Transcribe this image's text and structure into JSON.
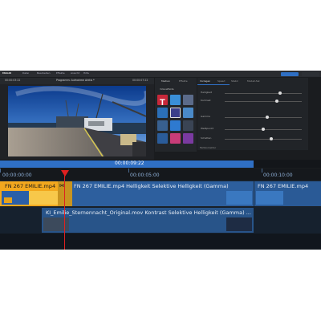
{
  "menu": {
    "logo": "MAGIX",
    "items": [
      "Datei",
      "Bearbeiten",
      "Effekte",
      "Ansicht",
      "Hilfe"
    ]
  },
  "preview": {
    "timecode_left": "00:00:03:22",
    "title": "Programm: Aufnahme Arktis *",
    "timecode_right": "00:00:07:22"
  },
  "fx_panel": {
    "tab1": "Medien",
    "tab2": "Effekte",
    "section": "Videoeffekte"
  },
  "props_panel": {
    "tabs": [
      "Vorlagen",
      "Speed",
      "Stabil",
      "Modell-fak"
    ],
    "rows": [
      {
        "label": "Helligkeit",
        "value": 0.72
      },
      {
        "label": "Kontrast",
        "value": 0.68
      },
      {
        "label": "Gamma",
        "value": 0.55
      },
      {
        "label": "Weißpunkt",
        "value": 0.5
      },
      {
        "label": "Schatten",
        "value": 0.6
      }
    ],
    "footer": "Farbkorrektur"
  },
  "timecode_bar": {
    "value": "00:00:09:22"
  },
  "ruler": {
    "labels": [
      "00:00:00:00",
      "00:00:05:00",
      "00:00:10:00"
    ]
  },
  "tracks": {
    "clip1_name": "FN 267 EMILIE.mp4",
    "clip2_name": "FN 267 EMILIE.mp4   Helligkeit  Selektive Helligkeit (Gamma)",
    "clip3_name": "FN 267 EMILIE.mp4",
    "clip4_name": "KI_Emilie_Sternennacht_Original.mov   Kontrast  Selektive Helligkeit (Gamma) ..."
  }
}
